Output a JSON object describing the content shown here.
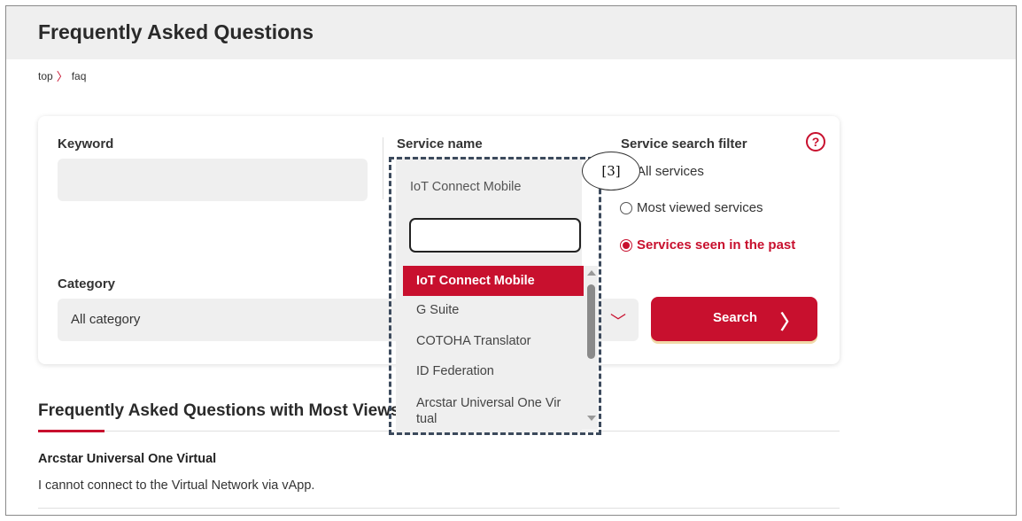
{
  "page": {
    "title": "Frequently Asked Questions",
    "breadcrumb": {
      "home": "top",
      "separator": "〉",
      "current": "faq"
    }
  },
  "search_form": {
    "keyword_label": "Keyword",
    "keyword_value": "",
    "service_label": "Service name",
    "filter_label": "Service search filter",
    "help_icon": "?",
    "filters": [
      {
        "label": "All services",
        "checked": false
      },
      {
        "label": "Most viewed services",
        "checked": false
      },
      {
        "label": "Services seen in the past",
        "checked": true
      }
    ],
    "category_label": "Category",
    "category_value": "All category",
    "category_chevron": "﹀",
    "search_button": "Search",
    "search_arrow": "〉"
  },
  "dropdown": {
    "current_value": "IoT Connect Mobile",
    "search_value": "",
    "options": [
      "IoT Connect Mobile",
      "G Suite",
      "COTOHA Translator",
      "ID Federation",
      "Arcstar Universal One Vir tual"
    ],
    "selected_index": 0
  },
  "faq_section": {
    "heading": "Frequently Asked Questions with Most Views",
    "items": [
      {
        "service": "Arcstar Universal One Virtual",
        "question": "I cannot connect to the Virtual Network via vApp."
      }
    ]
  },
  "annotation": {
    "callout": "[3]"
  },
  "colors": {
    "accent": "#c8102e",
    "panel_gray": "#efefef",
    "header_gray": "#efefef",
    "annotation_border": "#3c4a5c"
  },
  "icons": {
    "help": "question-circle-icon",
    "chevron": "chevron-down-icon",
    "arrow": "chevron-right-icon",
    "radio": "radio-icon"
  }
}
